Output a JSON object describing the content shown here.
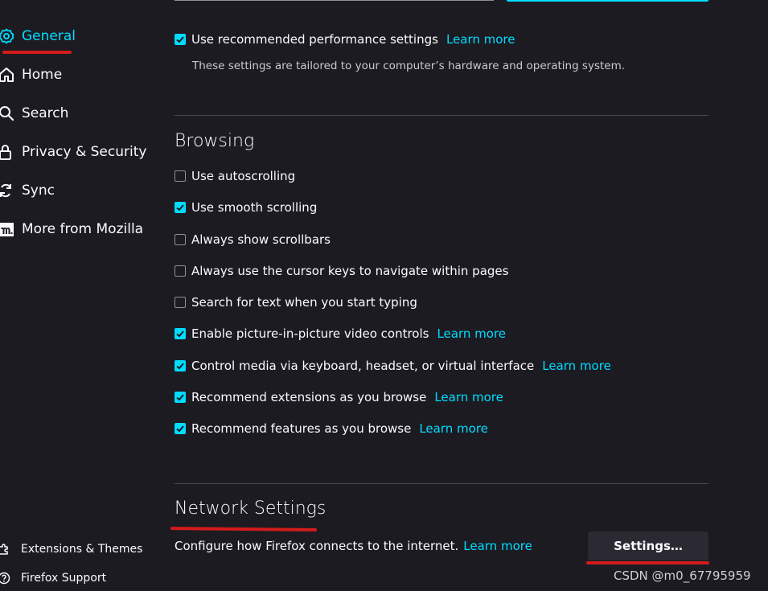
{
  "sidebar": {
    "items": [
      {
        "label": "General",
        "icon": "gear-icon",
        "selected": true
      },
      {
        "label": "Home",
        "icon": "home-icon",
        "selected": false
      },
      {
        "label": "Search",
        "icon": "search-icon",
        "selected": false
      },
      {
        "label": "Privacy & Security",
        "icon": "lock-icon",
        "selected": false
      },
      {
        "label": "Sync",
        "icon": "sync-icon",
        "selected": false
      },
      {
        "label": "More from Mozilla",
        "icon": "mozilla-icon",
        "selected": false
      }
    ],
    "footer": [
      {
        "label": "Extensions & Themes",
        "icon": "puzzle-icon"
      },
      {
        "label": "Firefox Support",
        "icon": "help-icon"
      }
    ]
  },
  "performance": {
    "label": "Use recommended performance settings",
    "checked": true,
    "link": "Learn more",
    "description": "These settings are tailored to your computer’s hardware and operating system."
  },
  "browsing": {
    "title": "Browsing",
    "options": [
      {
        "label": "Use autoscrolling",
        "checked": false,
        "link": ""
      },
      {
        "label": "Use smooth scrolling",
        "checked": true,
        "link": ""
      },
      {
        "label": "Always show scrollbars",
        "checked": false,
        "link": ""
      },
      {
        "label": "Always use the cursor keys to navigate within pages",
        "checked": false,
        "link": ""
      },
      {
        "label": "Search for text when you start typing",
        "checked": false,
        "link": ""
      },
      {
        "label": "Enable picture-in-picture video controls",
        "checked": true,
        "link": "Learn more"
      },
      {
        "label": "Control media via keyboard, headset, or virtual interface",
        "checked": true,
        "link": "Learn more"
      },
      {
        "label": "Recommend extensions as you browse",
        "checked": true,
        "link": "Learn more"
      },
      {
        "label": "Recommend features as you browse",
        "checked": true,
        "link": "Learn more"
      }
    ]
  },
  "network": {
    "title": "Network Settings",
    "description": "Configure how Firefox connects to the internet.",
    "link": "Learn more",
    "button": "Settings…"
  },
  "watermark": "CSDN @m0_67795959",
  "colors": {
    "accent": "#00ddff",
    "background": "#1c1b22",
    "annotation": "#d41b1b"
  }
}
